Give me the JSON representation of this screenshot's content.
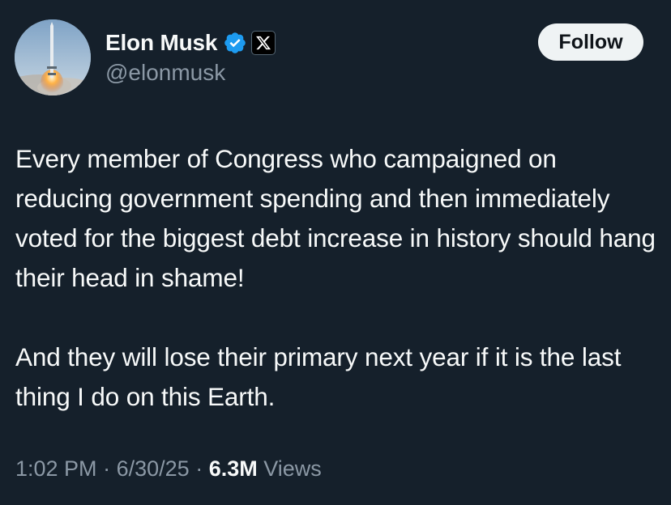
{
  "author": {
    "display_name": "Elon Musk",
    "handle": "@elonmusk",
    "verified_icon": "verified-badge-icon",
    "affiliate_icon": "x-logo-icon"
  },
  "follow_button": {
    "label": "Follow"
  },
  "tweet": {
    "paragraphs": [
      "Every member of Congress who campaigned on reducing government spending and then immediately voted for the biggest debt increase in history should hang their head in shame!",
      "And they will lose their primary next year if it is the last thing I do on this Earth."
    ]
  },
  "meta": {
    "time": "1:02 PM",
    "separator": "·",
    "date": "6/30/25",
    "views_count": "6.3M",
    "views_label": "Views"
  },
  "colors": {
    "background": "#15202b",
    "text_primary": "#f7f9f9",
    "text_secondary": "#8b98a5",
    "verified_blue": "#1d9bf0",
    "follow_bg": "#eff3f4"
  }
}
